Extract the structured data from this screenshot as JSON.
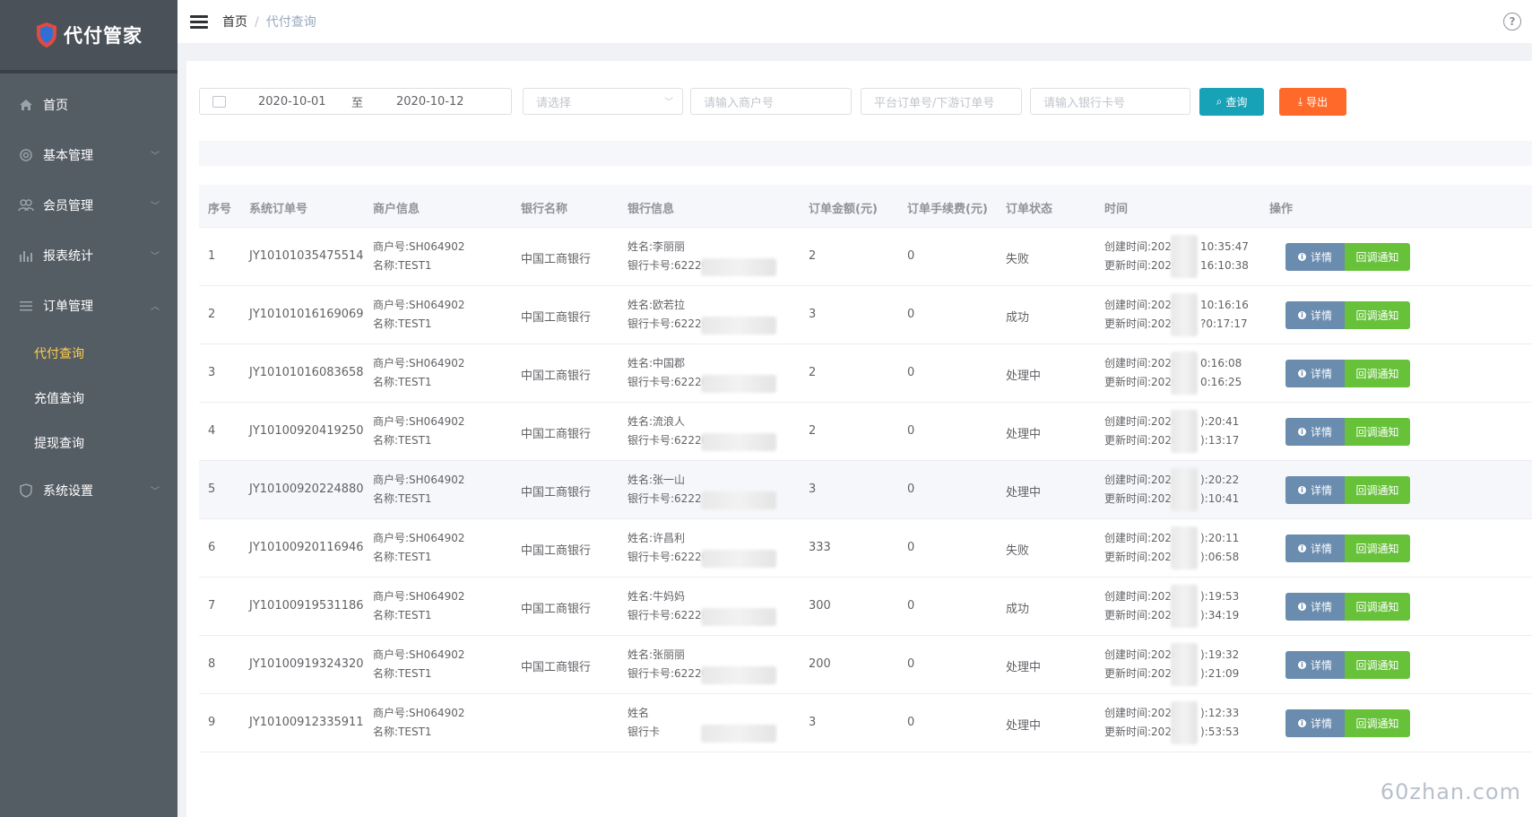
{
  "app": {
    "title": "代付管家"
  },
  "sidebar": {
    "items": [
      {
        "label": "首页"
      },
      {
        "label": "基本管理"
      },
      {
        "label": "会员管理"
      },
      {
        "label": "报表统计"
      },
      {
        "label": "订单管理"
      },
      {
        "label": "系统设置"
      }
    ],
    "subitems": [
      {
        "label": "代付查询",
        "active": true
      },
      {
        "label": "充值查询"
      },
      {
        "label": "提现查询"
      }
    ]
  },
  "breadcrumb": {
    "home": "首页",
    "separator": "/",
    "current": "代付查询"
  },
  "filters": {
    "date_start": "2020-10-01",
    "date_to": "至",
    "date_end": "2020-10-12",
    "select_placeholder": "请选择",
    "merchant_placeholder": "请输入商户号",
    "order_placeholder": "平台订单号/下游订单号",
    "bankcard_placeholder": "请输入银行卡号",
    "search_label": "查询",
    "export_label": "导出"
  },
  "table": {
    "columns": [
      "序号",
      "系统订单号",
      "商户信息",
      "银行名称",
      "银行信息",
      "订单金额(元)",
      "订单手续费(元)",
      "订单状态",
      "时间",
      "操作"
    ],
    "detail_label": "详情",
    "notify_label": "回调通知",
    "rows": [
      {
        "idx": "1",
        "order": "JY10101035475514",
        "merchant": "商户号:SH064902",
        "mname": "名称:TEST1",
        "bank": "中国工商银行",
        "holder": "姓名:李丽丽",
        "card": "银行卡号:62220",
        "amount": "2",
        "fee": "0",
        "status": "失败",
        "stype": "fail",
        "created": "创建时间:202",
        "created_tail": "10:35:47",
        "updated": "更新时间:2020",
        "updated_tail": "16:10:38"
      },
      {
        "idx": "2",
        "order": "JY10101016169069",
        "merchant": "商户号:SH064902",
        "mname": "名称:TEST1",
        "bank": "中国工商银行",
        "holder": "姓名:欧若拉",
        "card": "银行卡号:6222(",
        "amount": "3",
        "fee": "0",
        "status": "成功",
        "stype": "ok",
        "created": "创建时间:2020",
        "created_tail": "10:16:16",
        "updated": "更新时间:2020",
        "updated_tail": "?0:17:17"
      },
      {
        "idx": "3",
        "order": "JY10101016083658",
        "merchant": "商户号:SH064902",
        "mname": "名称:TEST1",
        "bank": "中国工商银行",
        "holder": "姓名:中国郡",
        "card": "银行卡号:622202",
        "amount": "2",
        "fee": "0",
        "status": "处理中",
        "stype": "proc",
        "created": "创建时间:2020",
        "created_tail": "0:16:08",
        "updated": "更新时间:2020",
        "updated_tail": "0:16:25"
      },
      {
        "idx": "4",
        "order": "JY10100920419250",
        "merchant": "商户号:SH064902",
        "mname": "名称:TEST1",
        "bank": "中国工商银行",
        "holder": "姓名:流浪人",
        "card": "银行卡号:62220",
        "amount": "2",
        "fee": "0",
        "status": "处理中",
        "stype": "proc",
        "created": "创建时间:2020",
        "created_tail": "):20:41",
        "updated": "更新时间:2020",
        "updated_tail": "):13:17"
      },
      {
        "idx": "5",
        "order": "JY10100920224880",
        "merchant": "商户号:SH064902",
        "mname": "名称:TEST1",
        "bank": "中国工商银行",
        "holder": "姓名:张一山",
        "card": "银行卡号:6222",
        "amount": "3",
        "fee": "0",
        "status": "处理中",
        "stype": "proc",
        "created": "创建时间:2020",
        "created_tail": "):20:22",
        "updated": "更新时间:202(",
        "updated_tail": "):10:41"
      },
      {
        "idx": "6",
        "order": "JY10100920116946",
        "merchant": "商户号:SH064902",
        "mname": "名称:TEST1",
        "bank": "中国工商银行",
        "holder": "姓名:许昌利",
        "card": "银行卡号:62220",
        "amount": "333",
        "fee": "0",
        "status": "失败",
        "stype": "fail",
        "created": "创建时间:202(",
        "created_tail": "):20:11",
        "updated": "更新时间:202(",
        "updated_tail": "):06:58"
      },
      {
        "idx": "7",
        "order": "JY10100919531186",
        "merchant": "商户号:SH064902",
        "mname": "名称:TEST1",
        "bank": "中国工商银行",
        "holder": "姓名:牛妈妈",
        "card": "银行卡号:6222(",
        "amount": "300",
        "fee": "0",
        "status": "成功",
        "stype": "ok",
        "created": "创建时间:202(",
        "created_tail": "):19:53",
        "updated": "更新时间:202(",
        "updated_tail": "):34:19"
      },
      {
        "idx": "8",
        "order": "JY10100919324320",
        "merchant": "商户号:SH064902",
        "mname": "名称:TEST1",
        "bank": "中国工商银行",
        "holder": "姓名:张丽丽",
        "card": "银行卡号:622202",
        "amount": "200",
        "fee": "0",
        "status": "处理中",
        "stype": "proc",
        "created": "创建时间:2020",
        "created_tail": "):19:32",
        "updated": "更新时间:2020",
        "updated_tail": "):21:09"
      },
      {
        "idx": "9",
        "order": "JY10100912335911",
        "merchant": "商户号:SH064902",
        "mname": "名称:TEST1",
        "bank": "",
        "holder": "姓名",
        "card": "银行卡",
        "amount": "3",
        "fee": "0",
        "status": "处理中",
        "stype": "proc",
        "created": "创建时间:2020-",
        "created_tail": "):12:33",
        "updated": "更新时间:2020-",
        "updated_tail": "):53:53"
      }
    ]
  },
  "colors": {
    "sidebar": "#545c64",
    "active": "#ffd04b",
    "search_btn": "#17a2b8",
    "export_btn": "#ff6a2b",
    "detail_btn": "#6a8caf",
    "notify_btn": "#67c23a"
  },
  "watermark": "60zhan.com"
}
